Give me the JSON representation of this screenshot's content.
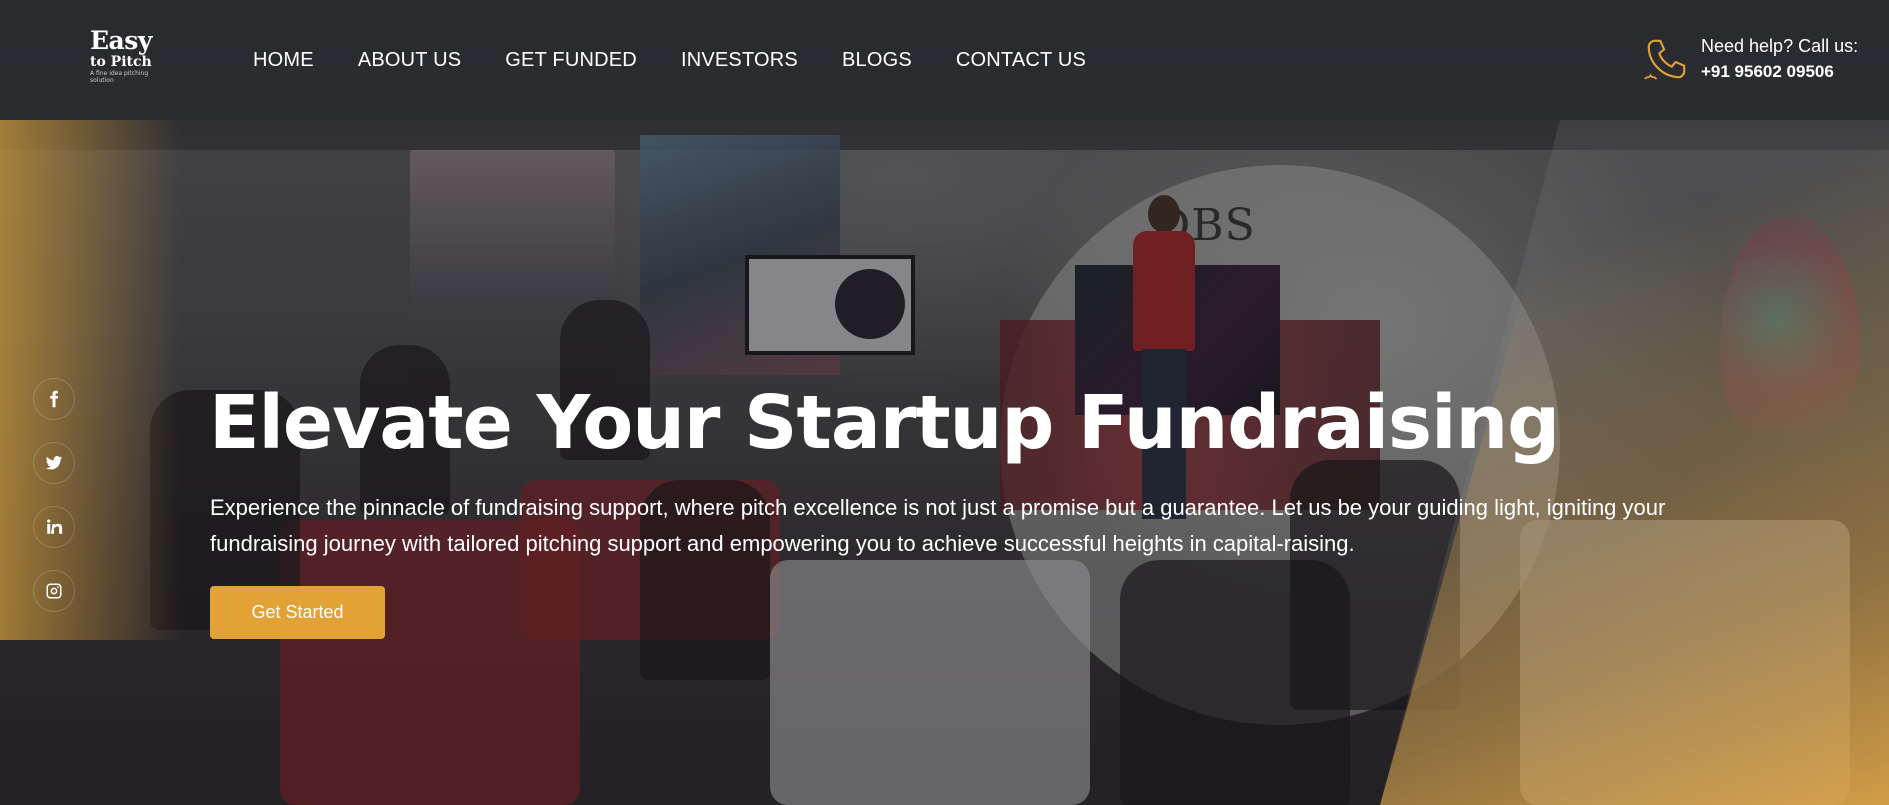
{
  "brand": {
    "line1": "Easy",
    "line2": "to Pitch",
    "tagline": "A fine idea pitching solution"
  },
  "nav": {
    "items": [
      {
        "label": "HOME"
      },
      {
        "label": "ABOUT US"
      },
      {
        "label": "GET FUNDED"
      },
      {
        "label": "INVESTORS"
      },
      {
        "label": "BLOGS"
      },
      {
        "label": "CONTACT US"
      }
    ]
  },
  "help": {
    "label": "Need help? Call us:",
    "phone": "+91 95602 09506",
    "icon": "phone-icon"
  },
  "social": [
    {
      "icon": "facebook-icon"
    },
    {
      "icon": "twitter-icon"
    },
    {
      "icon": "linkedin-icon"
    },
    {
      "icon": "instagram-icon"
    }
  ],
  "hero": {
    "title": "Elevate Your Startup Fundraising",
    "description": "Experience the pinnacle of fundraising support, where pitch excellence is not just a promise but a guarantee. Let us be your guiding light, igniting your fundraising journey with tailored pitching support and empowering you to achieve successful heights in capital-raising.",
    "cta_label": "Get Started"
  },
  "colors": {
    "accent": "#e2a236",
    "header_bg": "#2a2c30"
  }
}
